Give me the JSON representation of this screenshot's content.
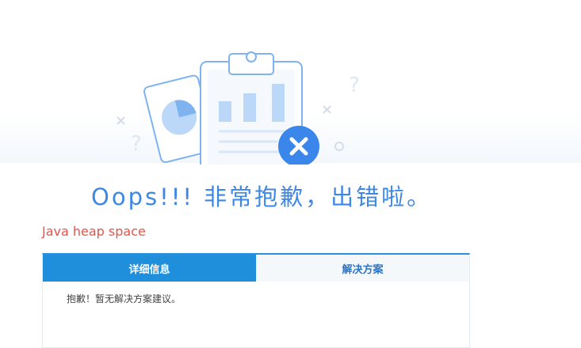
{
  "title": "Oops!!! 非常抱歉，出错啦。",
  "error_message": "Java heap space",
  "tabs": [
    {
      "label": "详细信息",
      "active": true
    },
    {
      "label": "解决方案",
      "active": false
    }
  ],
  "panel_content": "抱歉！暂无解决方案建议。",
  "colors": {
    "accent": "#3d87e6",
    "error": "#e8524a",
    "tab_active": "#1f8fdc"
  },
  "icons": [
    "clipboard-chart-icon",
    "pie-chart-card-icon",
    "error-x-icon",
    "question-mark-icon",
    "cross-mark-icon"
  ]
}
